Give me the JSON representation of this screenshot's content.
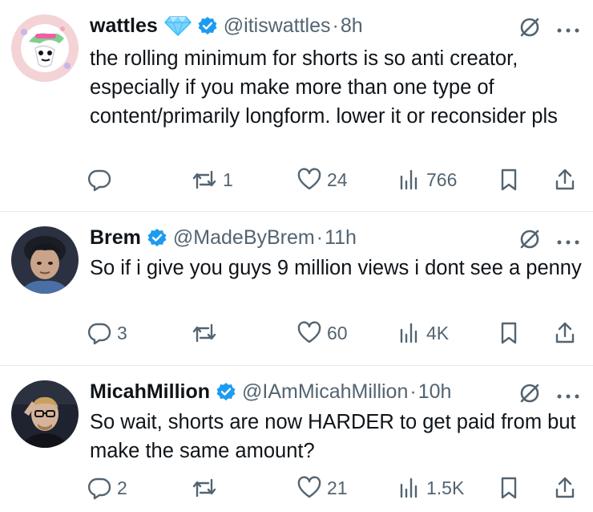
{
  "tweets": [
    {
      "name": "wattles",
      "handle": "@itiswattles",
      "time": "8h",
      "has_gem": true,
      "text": "the rolling minimum for shorts is so anti creator, especially if you make more than one type of content/primarily longform. lower it or reconsider pls",
      "replies": "",
      "reposts": "1",
      "likes": "24",
      "views": "766"
    },
    {
      "name": "Brem",
      "handle": "@MadeByBrem",
      "time": "11h",
      "text": "So if i give you guys 9 million views i dont see a penny",
      "replies": "3",
      "reposts": "",
      "likes": "60",
      "views": "4K"
    },
    {
      "name": "MicahMillion",
      "handle": "@IAmMicahMillion",
      "time": "10h",
      "text": "So wait, shorts are now HARDER to get paid from but make the same amount?",
      "replies": "2",
      "reposts": "",
      "likes": "21",
      "views": "1.5K"
    }
  ],
  "separator": "·",
  "colors": {
    "text": "#0f1419",
    "secondary": "#536471",
    "verified": "#1d9bf0",
    "divider": "#e7e9ec"
  },
  "icons": [
    "reply-icon",
    "repost-icon",
    "like-icon",
    "views-icon",
    "bookmark-icon",
    "share-icon",
    "grok-icon",
    "more-icon",
    "verified-badge-icon",
    "gem-icon"
  ]
}
